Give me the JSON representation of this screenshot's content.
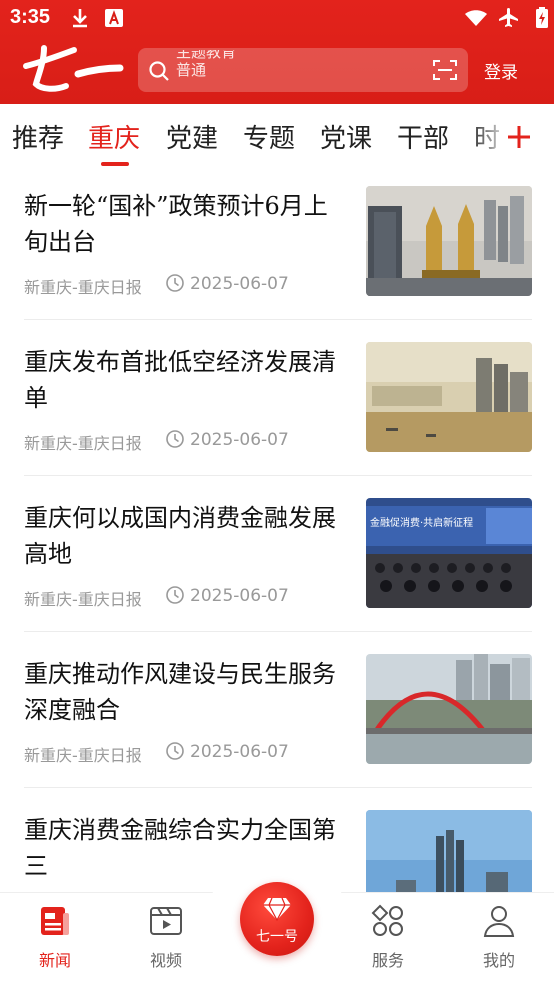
{
  "status": {
    "time": "3:35"
  },
  "header": {
    "logo_text": "七一",
    "search_placeholder_line1": "主题教育",
    "search_placeholder_line2": "普通",
    "login_label": "登录"
  },
  "tabs": [
    {
      "label": "推荐",
      "active": false
    },
    {
      "label": "重庆",
      "active": true
    },
    {
      "label": "党建",
      "active": false
    },
    {
      "label": "专题",
      "active": false
    },
    {
      "label": "党课",
      "active": false
    },
    {
      "label": "干部",
      "active": false
    },
    {
      "label": "时",
      "active": false
    }
  ],
  "news": [
    {
      "title": "新一轮“国补”政策预计6月上旬出台",
      "source": "新重庆-重庆日报",
      "date": "2025-06-07",
      "image": "city-skyline-towers"
    },
    {
      "title": "重庆发布首批低空经济发展清单",
      "source": "新重庆-重庆日报",
      "date": "2025-06-07",
      "image": "river-city-haze"
    },
    {
      "title": "重庆何以成国内消费金融发展高地",
      "source": "新重庆-重庆日报",
      "date": "2025-06-07",
      "image": "conference-hall",
      "image_banner": "金融促消费·共启新征程"
    },
    {
      "title": "重庆推动作风建设与民生服务深度融合",
      "source": "新重庆-重庆日报",
      "date": "2025-06-07",
      "image": "red-arch-bridge"
    },
    {
      "title": "重庆消费金融综合实力全国第三",
      "source": "",
      "date": "",
      "image": "skyline-blue-sky"
    }
  ],
  "bottom_nav": [
    {
      "label": "新闻",
      "icon": "news-icon",
      "active": true
    },
    {
      "label": "视频",
      "icon": "video-icon",
      "active": false
    },
    {
      "label": "七一号",
      "icon": "gem-icon",
      "active": false
    },
    {
      "label": "服务",
      "icon": "grid-icon",
      "active": false
    },
    {
      "label": "我的",
      "icon": "user-icon",
      "active": false
    }
  ],
  "colors": {
    "brand_red": "#e3231c",
    "text": "#111111",
    "meta": "#999999"
  }
}
